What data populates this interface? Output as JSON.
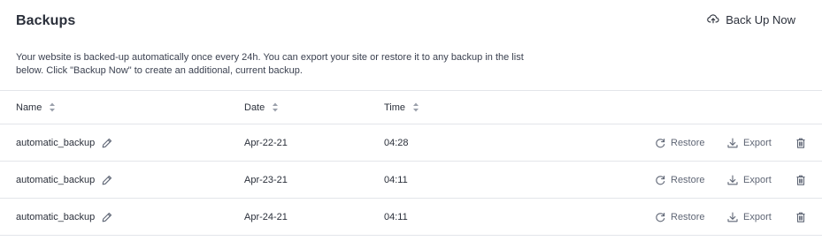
{
  "header": {
    "title": "Backups",
    "backup_now_label": "Back Up Now",
    "description": "Your website is backed-up automatically once every 24h. You can export your site or restore it to any backup in the list below. Click \"Backup Now\" to create an additional, current backup."
  },
  "table": {
    "columns": [
      "Name",
      "Date",
      "Time"
    ],
    "rows": [
      {
        "name": "automatic_backup",
        "date": "Apr-22-21",
        "time": "04:28"
      },
      {
        "name": "automatic_backup",
        "date": "Apr-23-21",
        "time": "04:11"
      },
      {
        "name": "automatic_backup",
        "date": "Apr-24-21",
        "time": "04:11"
      }
    ],
    "actions": {
      "restore": "Restore",
      "export": "Export"
    }
  },
  "icons": {
    "backup": "cloud-upload-icon",
    "sort": "sort-icon",
    "edit": "pencil-icon",
    "restore": "restore-icon",
    "export": "download-icon",
    "delete": "trash-icon"
  },
  "colors": {
    "text": "#2a2f3a",
    "muted": "#5f6675",
    "divider": "#e3e5ea"
  }
}
